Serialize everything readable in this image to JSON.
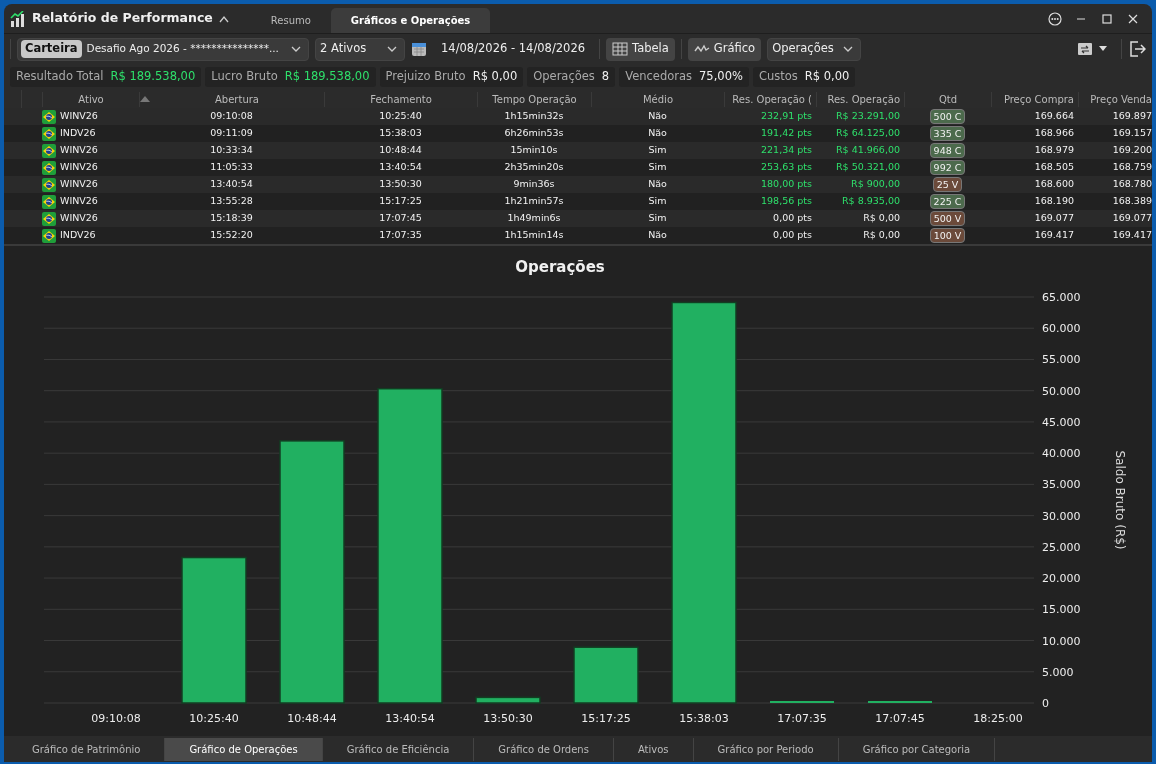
{
  "window": {
    "title": "Relatório de Performance"
  },
  "tabs": [
    {
      "label": "Resumo",
      "selected": false
    },
    {
      "label": "Gráficos e Operações",
      "selected": true
    }
  ],
  "toolbar": {
    "portfolio_tag": "Carteira",
    "portfolio": "Desafio Ago 2026 - ***************...",
    "assets": "2 Ativos",
    "date_range": "14/08/2026 - 14/08/2026",
    "table_button": "Tabela",
    "chart_button": "Gráfico",
    "chart_type": "Operações"
  },
  "stats": [
    {
      "label": "Resultado Total",
      "value": "R$ 189.538,00",
      "positive": true
    },
    {
      "label": "Lucro Bruto",
      "value": "R$ 189.538,00",
      "positive": true
    },
    {
      "label": "Prejuizo Bruto",
      "value": "R$ 0,00",
      "positive": false
    },
    {
      "label": "Operações",
      "value": "8",
      "positive": false
    },
    {
      "label": "Vencedoras",
      "value": "75,00%",
      "positive": false
    },
    {
      "label": "Custos",
      "value": "R$ 0,00",
      "positive": false
    }
  ],
  "table": {
    "columns": [
      "Ativo",
      "Abertura",
      "Fechamento",
      "Tempo Operação",
      "Médio",
      "Res. Operação (",
      "Res. Operação",
      "Qtd",
      "Preço Compra",
      "Preço Venda"
    ],
    "rows": [
      {
        "asset": "WINV26",
        "open": "09:10:08",
        "close": "10:25:40",
        "duration": "1h15min32s",
        "average": "Não",
        "result_pts": "232,91 pts",
        "result_brl": "R$ 23.291,00",
        "positive": true,
        "qty": "500 C",
        "kind": "buy",
        "buy_price": "169.664",
        "sell_price": "169.897"
      },
      {
        "asset": "INDV26",
        "open": "09:11:09",
        "close": "15:38:03",
        "duration": "6h26min53s",
        "average": "Não",
        "result_pts": "191,42 pts",
        "result_brl": "R$ 64.125,00",
        "positive": true,
        "qty": "335 C",
        "kind": "buy",
        "buy_price": "168.966",
        "sell_price": "169.157"
      },
      {
        "asset": "WINV26",
        "open": "10:33:34",
        "close": "10:48:44",
        "duration": "15min10s",
        "average": "Sim",
        "result_pts": "221,34 pts",
        "result_brl": "R$ 41.966,00",
        "positive": true,
        "qty": "948 C",
        "kind": "buy",
        "buy_price": "168.979",
        "sell_price": "169.200"
      },
      {
        "asset": "WINV26",
        "open": "11:05:33",
        "close": "13:40:54",
        "duration": "2h35min20s",
        "average": "Sim",
        "result_pts": "253,63 pts",
        "result_brl": "R$ 50.321,00",
        "positive": true,
        "qty": "992 C",
        "kind": "buy",
        "buy_price": "168.505",
        "sell_price": "168.759"
      },
      {
        "asset": "WINV26",
        "open": "13:40:54",
        "close": "13:50:30",
        "duration": "9min36s",
        "average": "Não",
        "result_pts": "180,00 pts",
        "result_brl": "R$ 900,00",
        "positive": true,
        "qty": "25 V",
        "kind": "sell",
        "buy_price": "168.600",
        "sell_price": "168.780"
      },
      {
        "asset": "WINV26",
        "open": "13:55:28",
        "close": "15:17:25",
        "duration": "1h21min57s",
        "average": "Sim",
        "result_pts": "198,56 pts",
        "result_brl": "R$ 8.935,00",
        "positive": true,
        "qty": "225 C",
        "kind": "buy",
        "buy_price": "168.190",
        "sell_price": "168.389"
      },
      {
        "asset": "WINV26",
        "open": "15:18:39",
        "close": "17:07:45",
        "duration": "1h49min6s",
        "average": "Sim",
        "result_pts": "0,00 pts",
        "result_brl": "R$ 0,00",
        "positive": false,
        "qty": "500 V",
        "kind": "sell",
        "buy_price": "169.077",
        "sell_price": "169.077"
      },
      {
        "asset": "INDV26",
        "open": "15:52:20",
        "close": "17:07:35",
        "duration": "1h15min14s",
        "average": "Não",
        "result_pts": "0,00 pts",
        "result_brl": "R$ 0,00",
        "positive": false,
        "qty": "100 V",
        "kind": "sell",
        "buy_price": "169.417",
        "sell_price": "169.417"
      }
    ]
  },
  "chart": {
    "chart_data": {
      "type": "bar",
      "title": "Operações",
      "ylabel": "Saldo Bruto (R$)",
      "categories": [
        "09:10:08",
        "10:25:40",
        "10:48:44",
        "13:40:54",
        "13:50:30",
        "15:17:25",
        "15:38:03",
        "17:07:35",
        "17:07:45",
        "18:25:00"
      ],
      "grid": true,
      "series": [
        {
          "color": "#21b061",
          "values": [
            null,
            23291,
            41966,
            50321,
            900,
            8935,
            64125,
            0,
            0,
            null
          ]
        }
      ],
      "ylim": [
        0,
        65000
      ],
      "yticks": [
        {
          "value": 0,
          "label": "0"
        },
        {
          "value": 5000,
          "label": "5.000"
        },
        {
          "value": 10000,
          "label": "10.000"
        },
        {
          "value": 15000,
          "label": "15.000"
        },
        {
          "value": 20000,
          "label": "20.000"
        },
        {
          "value": 25000,
          "label": "25.000"
        },
        {
          "value": 30000,
          "label": "30.000"
        },
        {
          "value": 35000,
          "label": "35.000"
        },
        {
          "value": 40000,
          "label": "40.000"
        },
        {
          "value": 45000,
          "label": "45.000"
        },
        {
          "value": 50000,
          "label": "50.000"
        },
        {
          "value": 55000,
          "label": "55.000"
        },
        {
          "value": 60000,
          "label": "60.000"
        },
        {
          "value": 65000,
          "label": "65.000"
        }
      ]
    }
  },
  "bottom_tabs": [
    {
      "label": "Gráfico de Patrimônio",
      "selected": false
    },
    {
      "label": "Gráfico de Operações",
      "selected": true
    },
    {
      "label": "Gráfico de Eficiência",
      "selected": false
    },
    {
      "label": "Gráfico de Ordens",
      "selected": false
    },
    {
      "label": "Ativos",
      "selected": false
    },
    {
      "label": "Gráfico por Periodo",
      "selected": false
    },
    {
      "label": "Gráfico por Categoria",
      "selected": false
    }
  ]
}
